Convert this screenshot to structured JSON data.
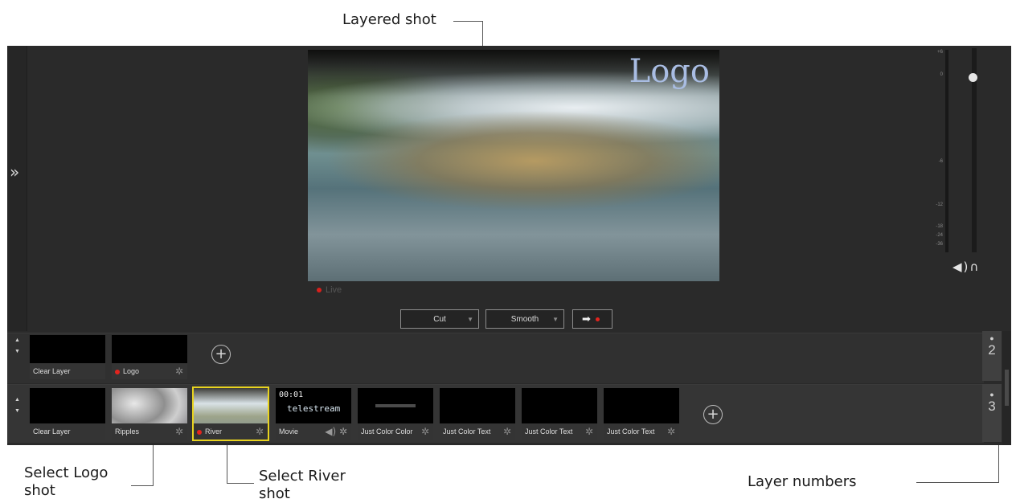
{
  "callouts": {
    "layered_shot": "Layered shot",
    "select_logo_1": "Select Logo",
    "select_logo_2": "shot",
    "select_river_1": "Select River",
    "select_river_2": "shot",
    "layer_numbers": "Layer numbers"
  },
  "preview": {
    "logo_text": "Logo",
    "live_label": "Live"
  },
  "transitions": {
    "cut": "Cut",
    "smooth": "Smooth",
    "go_icon": "arrow-right-icon"
  },
  "audio": {
    "meter_labels": [
      "+6",
      "0",
      "-6",
      "-12",
      "-18",
      "-24",
      "-36"
    ],
    "speaker_icon": "speaker-icon",
    "headphones_icon": "headphones-icon"
  },
  "layers": [
    {
      "number": "2",
      "shots": [
        {
          "label": "Clear Layer"
        },
        {
          "label": "Logo",
          "live": true
        }
      ]
    },
    {
      "number": "3",
      "shots": [
        {
          "label": "Clear Layer"
        },
        {
          "label": "Ripples"
        },
        {
          "label": "River",
          "live": true,
          "selected": true
        },
        {
          "label": "Movie",
          "timecode": "00:01",
          "brand": "telestream"
        },
        {
          "label": "Just Color Color"
        },
        {
          "label": "Just Color Text"
        },
        {
          "label": "Just Color Text"
        },
        {
          "label": "Just Color Text"
        }
      ]
    }
  ]
}
